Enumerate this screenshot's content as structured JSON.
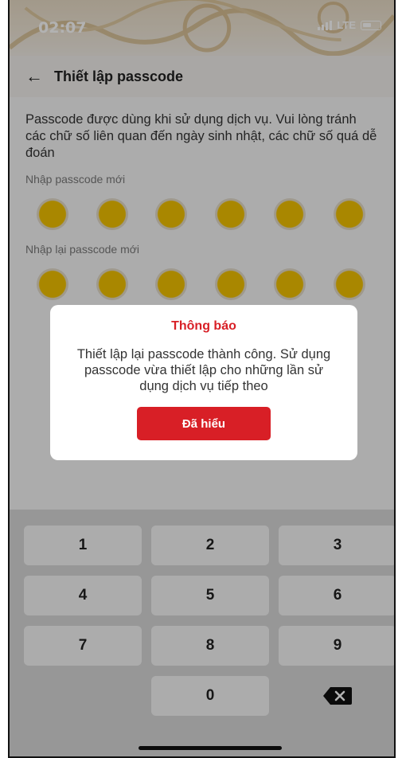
{
  "status_bar": {
    "time": "02:07",
    "network": "LTE"
  },
  "header": {
    "title": "Thiết lập passcode"
  },
  "content": {
    "description": "Passcode được dùng khi sử dụng dịch vụ. Vui lòng tránh các chữ số liên quan đến ngày sinh nhật, các chữ số quá dễ đoán",
    "new_passcode_label": "Nhập passcode mới",
    "confirm_passcode_label": "Nhập lại passcode mới",
    "digits_per_passcode": 6
  },
  "dialog": {
    "title": "Thông báo",
    "message": "Thiết lập lại passcode thành công. Sử dụng passcode vừa thiết lập cho những lần sử dụng dịch vụ tiếp theo",
    "button_label": "Đã hiểu"
  },
  "keypad": {
    "keys": [
      "1",
      "2",
      "3",
      "4",
      "5",
      "6",
      "7",
      "8",
      "9",
      "",
      "0",
      "delete"
    ]
  },
  "colors": {
    "accent": "#d81f26",
    "pin_filled": "#f2c200"
  }
}
